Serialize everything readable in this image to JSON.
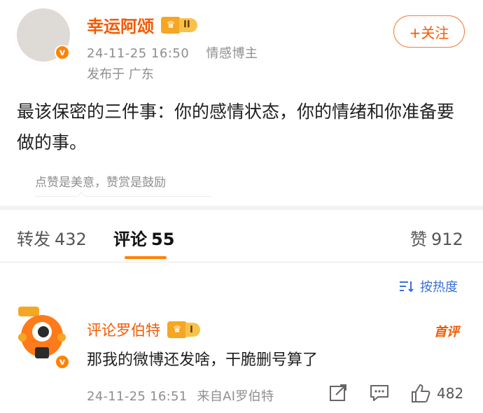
{
  "post": {
    "username": "幸运阿颂",
    "rank_label": "II",
    "timestamp": "24-11-25 16:50",
    "tag": "情感博主",
    "location": "发布于 广东",
    "follow_label": "+关注",
    "text": "最该保密的三件事：你的感情状态，你的情绪和你准备要做的事。",
    "reward_text": "点赞是美意，赞赏是鼓励"
  },
  "tabs": {
    "repost_label": "转发",
    "repost_count": "432",
    "comment_label": "评论",
    "comment_count": "55",
    "like_label": "赞",
    "like_count": "912"
  },
  "sort": {
    "label": "按热度"
  },
  "comment": {
    "username": "评论罗伯特",
    "rank_label": "I",
    "first_badge": "首评",
    "text": "那我的微博还发啥，干脆删号算了",
    "timestamp": "24-11-25 16:51",
    "source": "来自AI罗伯特",
    "like_count": "482"
  },
  "colors": {
    "accent": "#f25a00",
    "link": "#3b6fd6",
    "muted": "#8e8e8e"
  },
  "icons": [
    "verified-badge-icon",
    "crown-icon",
    "sort-icon",
    "share-icon",
    "comment-icon",
    "like-icon"
  ]
}
